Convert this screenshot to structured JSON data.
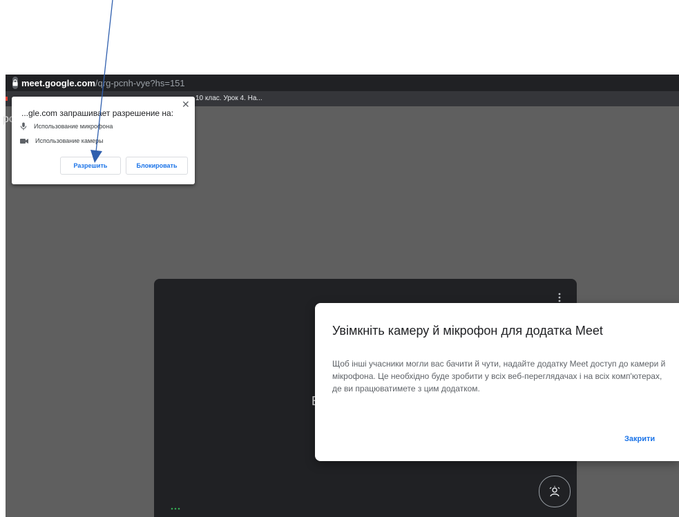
{
  "browser": {
    "url_host": "meet.google.com",
    "url_path": "/qrg-pcnh-vye?hs=151",
    "bookmark_item": "10 клас. Урок 4. На..."
  },
  "background": {
    "edge_text": "рс"
  },
  "permission_popup": {
    "title": "...gle.com запрашивает разрешение на:",
    "items": [
      {
        "label": "Использование микрофона",
        "icon": "microphone-icon"
      },
      {
        "label": "Использование камеры",
        "icon": "camera-icon"
      }
    ],
    "allow_label": "Разрешить",
    "block_label": "Блокировать",
    "close_glyph": "✕"
  },
  "video_tile": {
    "partial_text": "Вм"
  },
  "meet_dialog": {
    "title": "Увімкніть камеру й мікрофон для додатка Meet",
    "body": "Щоб інші учасники могли вас бачити й чути, надайте додатку Meet доступ до камери й мікрофона. Це необхідно буде зробити у всіх веб-переглядачах і на всіх комп'ютерах, де ви працюватимете з цим додатком.",
    "close_label": "Закрити"
  },
  "colors": {
    "accent": "#1a73e8",
    "annotation_arrow": "#2f5fae",
    "meet_green": "#34a853"
  }
}
